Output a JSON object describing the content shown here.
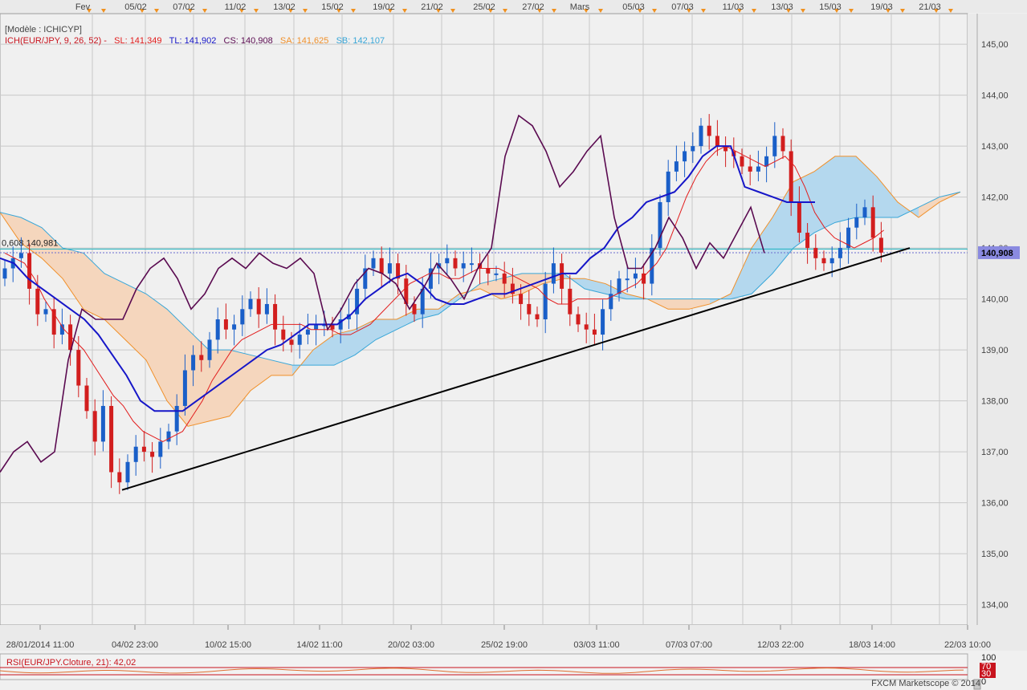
{
  "header": {
    "model_label": "[Modèle : ICHICYP]",
    "ind_name": "ICH(EUR/JPY, 9, 26, 52) -",
    "sl": "SL: 141,349",
    "tl": "TL: 141,902",
    "cs": "CS: 140,908",
    "sa": "SA: 141,625",
    "sb": "SB: 142,107"
  },
  "colors": {
    "background": "#f0f0f0",
    "grid": "#c8c8c8",
    "candle_up": "#1a5fc8",
    "candle_down": "#d21e1e",
    "tenkan": "#e21d1d",
    "kijun": "#1616c8",
    "chikou": "#5a0a50",
    "cloud_bull": "#b4d8ee",
    "cloud_bear": "#f5d6bd",
    "senkou_a": "#f0902a",
    "senkou_b": "#38a6d8",
    "level_line": "#1ab2c0",
    "price_tag": "#8a8ae0",
    "trendline": "#000000",
    "marker": "#f0901e"
  },
  "top_dates": [
    "Fev",
    "05/02",
    "07/02",
    "11/02",
    "13/02",
    "15/02",
    "19/02",
    "21/02",
    "25/02",
    "27/02",
    "Mars",
    "05/03",
    "07/03",
    "11/03",
    "13/03",
    "15/03",
    "19/03",
    "21/03"
  ],
  "bottom_dates": [
    "28/01/2014 11:00",
    "04/02 23:00",
    "10/02 15:00",
    "14/02 11:00",
    "20/02 03:00",
    "25/02 19:00",
    "03/03 11:00",
    "07/03 07:00",
    "12/03 22:00",
    "18/03 14:00",
    "22/03 10:00"
  ],
  "level_label": "0,608 140,981",
  "price_tag_value": "140,908",
  "rsi_label": "RSI(EUR/JPY.Cloture, 21): 42,02",
  "rsi_ticks": [
    "100",
    "70",
    "30",
    "0"
  ],
  "copyright": "FXCM Marketscope © 2014",
  "chart_data": {
    "type": "candlestick",
    "ylim": [
      133.6,
      145.6
    ],
    "y_ticks": [
      134,
      135,
      136,
      137,
      138,
      139,
      140,
      141,
      142,
      143,
      144,
      145
    ],
    "y_tick_labels": [
      "134,00",
      "135,00",
      "136,00",
      "137,00",
      "138,00",
      "139,00",
      "140,00",
      "141,00",
      "142,00",
      "143,00",
      "144,00",
      "145,00"
    ],
    "level_lines": [
      140.98
    ],
    "last_price": 140.908,
    "trendline": {
      "from": [
        "04/02 23:00",
        136.25
      ],
      "to": [
        "20/03",
        141.0
      ]
    },
    "series": [
      {
        "name": "Close",
        "y": [
          140.6,
          140.8,
          140.9,
          140.2,
          139.7,
          139.8,
          139.3,
          139.5,
          139.0,
          138.3,
          137.8,
          137.2,
          137.9,
          136.6,
          136.4,
          136.8,
          137.1,
          137.0,
          136.9,
          137.2,
          137.4,
          137.9,
          138.6,
          138.9,
          138.8,
          139.2,
          139.6,
          139.4,
          139.5,
          139.8,
          140.0,
          139.7,
          139.9,
          139.4,
          139.2,
          139.1,
          139.3,
          139.4,
          139.5,
          139.5,
          139.4,
          139.6,
          139.7,
          140.2,
          140.6,
          140.8,
          140.5,
          140.7,
          140.4,
          139.9,
          139.7,
          140.2,
          140.6,
          140.7,
          140.8,
          140.6,
          140.7,
          140.7,
          140.6,
          140.5,
          140.5,
          140.3,
          140.1,
          139.9,
          139.7,
          139.6,
          140.3,
          140.7,
          140.2,
          139.7,
          139.5,
          139.4,
          139.3,
          139.8,
          140.1,
          140.4,
          140.4,
          140.5,
          140.3,
          141.0,
          141.9,
          142.5,
          142.7,
          142.9,
          143.0,
          143.4,
          143.2,
          143.0,
          142.9,
          142.8,
          142.6,
          142.5,
          142.6,
          142.8,
          143.2,
          142.9,
          141.9,
          141.3,
          141.0,
          140.8,
          140.7,
          140.8,
          141.0,
          141.4,
          141.6,
          141.8,
          141.2,
          140.91
        ]
      },
      {
        "name": "Tenkan",
        "y": [
          140.9,
          140.8,
          140.7,
          140.4,
          140.0,
          139.7,
          139.4,
          139.2,
          139.0,
          138.7,
          138.4,
          138.1,
          137.9,
          137.6,
          137.4,
          137.3,
          137.2,
          137.3,
          137.4,
          137.7,
          138.0,
          138.4,
          138.7,
          139.0,
          139.2,
          139.3,
          139.4,
          139.5,
          139.5,
          139.5,
          139.5,
          139.4,
          139.4,
          139.4,
          139.3,
          139.3,
          139.4,
          139.5,
          139.7,
          139.9,
          140.1,
          140.3,
          140.4,
          140.5,
          140.5,
          140.4,
          140.4,
          140.5,
          140.6,
          140.6,
          140.6,
          140.5,
          140.4,
          140.3,
          140.2,
          140.0,
          139.9,
          139.9,
          140.0,
          140.0,
          140.0,
          140.0,
          140.1,
          140.2,
          140.3,
          140.5,
          140.7,
          141.0,
          141.5,
          142.0,
          142.4,
          142.7,
          142.9,
          143.0,
          142.9,
          142.8,
          142.7,
          142.6,
          142.7,
          142.8,
          142.6,
          142.2,
          141.7,
          141.4,
          141.2,
          141.1,
          141.0,
          141.1,
          141.2,
          141.35
        ]
      },
      {
        "name": "Kijun",
        "y": [
          140.8,
          140.7,
          140.4,
          140.2,
          140.0,
          139.8,
          139.6,
          139.3,
          138.9,
          138.5,
          138.0,
          137.8,
          137.8,
          137.8,
          138.0,
          138.2,
          138.4,
          138.6,
          138.8,
          139.0,
          139.1,
          139.3,
          139.5,
          139.5,
          139.5,
          139.7,
          140.0,
          140.2,
          140.4,
          140.5,
          140.3,
          140.0,
          139.9,
          139.9,
          140.0,
          140.1,
          140.1,
          140.2,
          140.3,
          140.4,
          140.5,
          140.5,
          140.8,
          141.0,
          141.4,
          141.6,
          141.9,
          142.0,
          142.1,
          142.4,
          142.8,
          143.0,
          143.0,
          142.2,
          142.1,
          142.0,
          141.9,
          141.9,
          141.9
        ]
      },
      {
        "name": "Chikou",
        "y": [
          136.6,
          137.0,
          137.2,
          136.8,
          137.0,
          138.8,
          139.8,
          139.6,
          139.6,
          139.6,
          140.2,
          140.6,
          140.8,
          140.4,
          139.8,
          140.1,
          140.6,
          140.8,
          140.6,
          140.9,
          140.7,
          140.6,
          140.8,
          140.5,
          139.4,
          139.8,
          140.3,
          140.6,
          140.5,
          140.3,
          139.8,
          140.2,
          140.7,
          140.4,
          140.0,
          140.6,
          141.0,
          142.8,
          143.6,
          143.4,
          142.9,
          142.2,
          142.5,
          142.9,
          143.2,
          141.6,
          140.6,
          140.6,
          141.0,
          141.6,
          141.2,
          140.6,
          141.1,
          140.8,
          141.3,
          141.8,
          140.9
        ]
      }
    ],
    "cloud": {
      "senkou_a": [
        141.7,
        141.1,
        140.8,
        140.4,
        139.8,
        139.6,
        139.2,
        138.8,
        138.0,
        137.5,
        137.6,
        137.7,
        138.2,
        138.5,
        138.5,
        139.0,
        139.3,
        139.4,
        139.6,
        139.6,
        139.8,
        139.8,
        140.1,
        140.2,
        140.0,
        140.1,
        140.3,
        140.4,
        140.4,
        140.3,
        140.1,
        140.0,
        139.8,
        139.8,
        139.9,
        140.1,
        141.0,
        141.6,
        142.3,
        142.5,
        142.8,
        142.8,
        142.4,
        141.9,
        141.6,
        141.9,
        142.1
      ],
      "senkou_b": [
        141.7,
        141.6,
        141.4,
        141.0,
        140.9,
        140.5,
        140.3,
        140.1,
        139.8,
        139.4,
        139.0,
        139.0,
        138.9,
        138.8,
        138.7,
        138.7,
        138.7,
        138.9,
        139.2,
        139.4,
        139.6,
        139.7,
        140.0,
        140.3,
        140.4,
        140.5,
        140.5,
        140.5,
        140.2,
        140.1,
        140.0,
        140.0,
        140.0,
        140.0,
        140.0,
        140.0,
        140.1,
        140.5,
        141.0,
        141.3,
        141.5,
        141.6,
        141.6,
        141.6,
        141.8,
        142.0,
        142.1
      ]
    }
  }
}
